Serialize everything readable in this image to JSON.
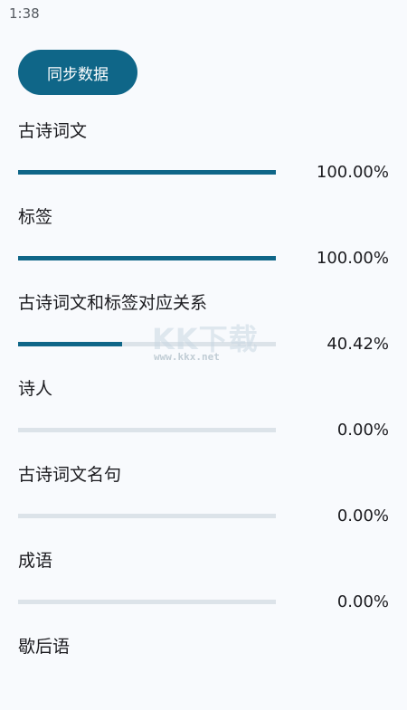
{
  "status_bar": {
    "time": "1:38"
  },
  "sync_button": {
    "label": "同步数据"
  },
  "items": [
    {
      "label": "古诗词文",
      "percent_text": "100.00%",
      "progress": 1.0
    },
    {
      "label": "标签",
      "percent_text": "100.00%",
      "progress": 1.0
    },
    {
      "label": "古诗词文和标签对应关系",
      "percent_text": "40.42%",
      "progress": 0.4042
    },
    {
      "label": "诗人",
      "percent_text": "0.00%",
      "progress": 0.0
    },
    {
      "label": "古诗词文名句",
      "percent_text": "0.00%",
      "progress": 0.0
    },
    {
      "label": "成语",
      "percent_text": "0.00%",
      "progress": 0.0
    },
    {
      "label": "歇后语",
      "percent_text": "",
      "progress": null
    }
  ],
  "watermark": {
    "logo": "KK下载",
    "url": "www.kkx.net"
  },
  "colors": {
    "accent": "#0f6688",
    "track": "#dce3e9",
    "background": "#f8fafd"
  }
}
